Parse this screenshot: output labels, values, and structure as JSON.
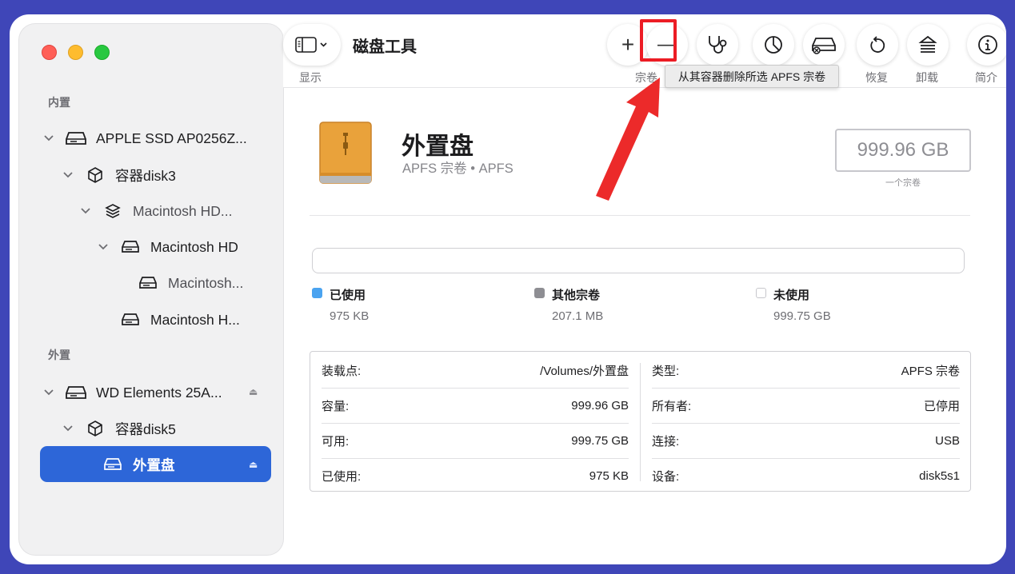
{
  "app": {
    "title": "磁盘工具"
  },
  "toolbar": {
    "view_label": "显示",
    "add_label": "+",
    "remove_label": "—",
    "volume_label": "宗卷",
    "restore_label": "恢复",
    "unmount_label": "卸载",
    "info_label": "简介",
    "tooltip": "从其容器删除所选 APFS 宗卷"
  },
  "sidebar": {
    "internal_title": "内置",
    "external_title": "外置",
    "items": [
      {
        "label": "APPLE SSD AP0256Z..."
      },
      {
        "label": "容器disk3"
      },
      {
        "label": "Macintosh HD..."
      },
      {
        "label": "Macintosh HD"
      },
      {
        "label": "Macintosh..."
      },
      {
        "label": "Macintosh H..."
      },
      {
        "label": "WD Elements 25A..."
      },
      {
        "label": "容器disk5"
      },
      {
        "label": "外置盘"
      }
    ]
  },
  "volume": {
    "name": "外置盘",
    "subtitle": "APFS 宗卷 • APFS",
    "size": "999.96 GB",
    "size_caption": "一个宗卷"
  },
  "usage": {
    "used": {
      "label": "已使用",
      "value": "975 KB",
      "color": "#4a90e2"
    },
    "other": {
      "label": "其他宗卷",
      "value": "207.1 MB",
      "color": "#8e8e93"
    },
    "free": {
      "label": "未使用",
      "value": "999.75 GB",
      "color": "#ffffff"
    }
  },
  "info": {
    "left": [
      {
        "key": "装载点:",
        "value": "/Volumes/外置盘"
      },
      {
        "key": "容量:",
        "value": "999.96 GB"
      },
      {
        "key": "可用:",
        "value": "999.75 GB"
      },
      {
        "key": "已使用:",
        "value": "975 KB"
      }
    ],
    "right": [
      {
        "key": "类型:",
        "value": "APFS 宗卷"
      },
      {
        "key": "所有者:",
        "value": "已停用"
      },
      {
        "key": "连接:",
        "value": "USB"
      },
      {
        "key": "设备:",
        "value": "disk5s1"
      }
    ]
  }
}
